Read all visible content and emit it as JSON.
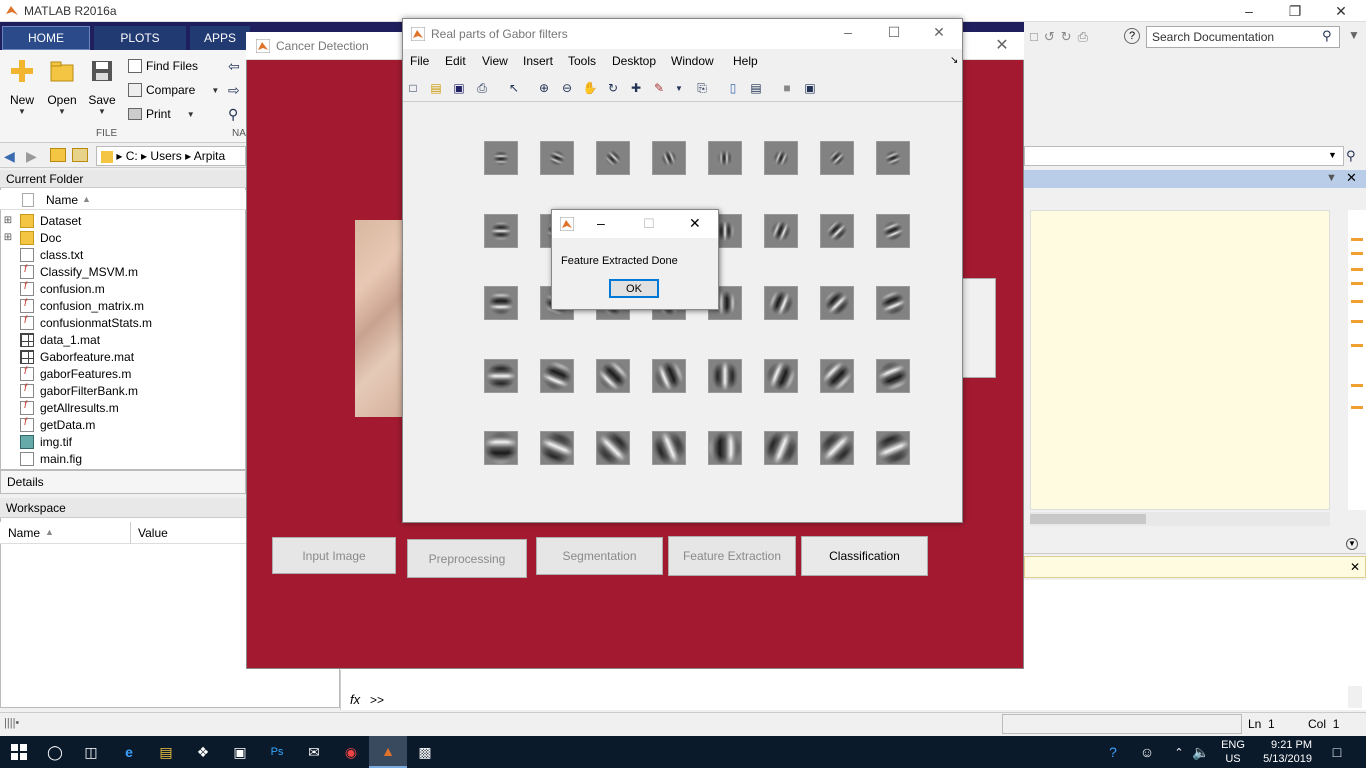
{
  "matlab": {
    "title": "MATLAB R2016a",
    "tabs": [
      "HOME",
      "PLOTS",
      "APPS"
    ],
    "ribbon": {
      "new": "New",
      "open": "Open",
      "save": "Save",
      "find_files": "Find Files",
      "compare": "Compare",
      "print": "Print",
      "section_file": "FILE",
      "section_na": "NA"
    },
    "search_placeholder": "Search Documentation",
    "address_path": [
      "C:",
      "Users",
      "Arpita"
    ],
    "current_folder": {
      "title": "Current Folder",
      "col_name": "Name",
      "items": [
        {
          "name": "Dataset",
          "type": "folder",
          "expandable": true
        },
        {
          "name": "Doc",
          "type": "folder",
          "expandable": true
        },
        {
          "name": "class.txt",
          "type": "txt"
        },
        {
          "name": "Classify_MSVM.m",
          "type": "m"
        },
        {
          "name": "confusion.m",
          "type": "m"
        },
        {
          "name": "confusion_matrix.m",
          "type": "m"
        },
        {
          "name": "confusionmatStats.m",
          "type": "m"
        },
        {
          "name": "data_1.mat",
          "type": "mat"
        },
        {
          "name": "Gaborfeature.mat",
          "type": "mat"
        },
        {
          "name": "gaborFeatures.m",
          "type": "m"
        },
        {
          "name": "gaborFilterBank.m",
          "type": "m"
        },
        {
          "name": "getAllresults.m",
          "type": "m"
        },
        {
          "name": "getData.m",
          "type": "m"
        },
        {
          "name": "img.tif",
          "type": "tif"
        },
        {
          "name": "main.fig",
          "type": "fig"
        }
      ]
    },
    "details_label": "Details",
    "workspace": {
      "title": "Workspace",
      "col_name": "Name",
      "col_value": "Value"
    },
    "cmd_prompt": ">>",
    "status": {
      "ln_label": "Ln",
      "ln": "1",
      "col_label": "Col",
      "col": "1"
    }
  },
  "cancer_detection": {
    "title": "Cancer Detection",
    "buttons": [
      "Input Image",
      "Preprocessing",
      "Segmentation",
      "Feature Extraction",
      "Classification"
    ]
  },
  "gabor_figure": {
    "title": "Real parts of Gabor filters",
    "menu": [
      "File",
      "Edit",
      "View",
      "Insert",
      "Tools",
      "Desktop",
      "Window",
      "Help"
    ],
    "rows": 5,
    "cols": 8
  },
  "dialog": {
    "message": "Feature Extracted Done",
    "ok": "OK"
  },
  "taskbar": {
    "lang": "ENG",
    "region": "US",
    "time": "9:21 PM",
    "date": "5/13/2019"
  }
}
